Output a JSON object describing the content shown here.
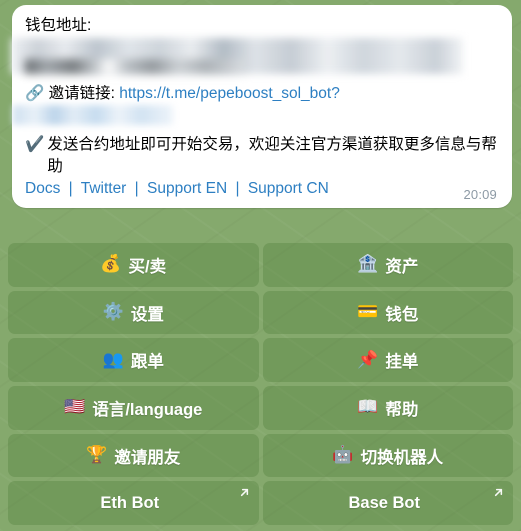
{
  "chat": {
    "wallpaper_color": "#85a96d",
    "bubble_bg": "#ffffff"
  },
  "message": {
    "wallet_label": "钱包地址:",
    "wallet_address_redacted": "",
    "balance_redacted": "",
    "invite_icon": "link-icon",
    "invite_label": "邀请链接:",
    "invite_url": "https://t.me/pepeboost_sol_bot?",
    "invite_url_redacted": "",
    "check_icon": "✔️",
    "notice": "发送合约地址即可开始交易，欢迎关注官方渠道获取更多信息与帮助",
    "links": [
      {
        "label": "Docs"
      },
      {
        "label": "Twitter"
      },
      {
        "label": "Support EN"
      },
      {
        "label": "Support CN"
      }
    ],
    "link_separator": "|",
    "link_color": "#2d7fc2",
    "timestamp": "20:09"
  },
  "keyboard": {
    "rows": [
      [
        {
          "emoji": "💰",
          "icon_name": "money-bag-icon",
          "label": "买/卖",
          "type": "text"
        },
        {
          "emoji": "🏦",
          "icon_name": "bank-icon",
          "label": "资产",
          "type": "text"
        }
      ],
      [
        {
          "emoji": "⚙️",
          "icon_name": "gear-icon",
          "label": "设置",
          "type": "text"
        },
        {
          "emoji": "💳",
          "icon_name": "credit-card-icon",
          "label": "钱包",
          "type": "text"
        }
      ],
      [
        {
          "emoji": "👥",
          "icon_name": "people-icon",
          "label": "跟单",
          "type": "text"
        },
        {
          "emoji": "📌",
          "icon_name": "pushpin-icon",
          "label": "挂单",
          "type": "text"
        }
      ],
      [
        {
          "emoji": "🇺🇸",
          "icon_name": "us-flag-icon",
          "label": "语言/language",
          "type": "text"
        },
        {
          "emoji": "📖",
          "icon_name": "open-book-icon",
          "label": "帮助",
          "type": "text"
        }
      ],
      [
        {
          "emoji": "🏆",
          "icon_name": "trophy-icon",
          "label": "邀请朋友",
          "type": "text"
        },
        {
          "emoji": "🤖",
          "icon_name": "robot-icon",
          "label": "切换机器人",
          "type": "text"
        }
      ],
      [
        {
          "emoji": "",
          "icon_name": "external-link-icon",
          "label": "Eth Bot",
          "type": "webapp"
        },
        {
          "emoji": "",
          "icon_name": "external-link-icon",
          "label": "Base Bot",
          "type": "webapp"
        }
      ]
    ]
  }
}
